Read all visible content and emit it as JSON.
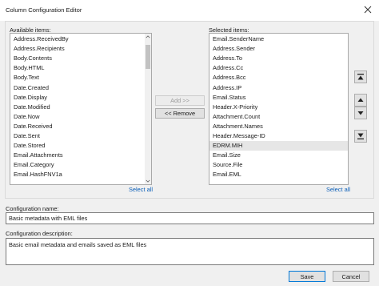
{
  "window": {
    "title": "Column Configuration Editor",
    "close_icon": "close-icon"
  },
  "available": {
    "label": "Available items:",
    "items": [
      "Address.ReceivedBy",
      "Address.Recipients",
      "Body.Contents",
      "Body.HTML",
      "Body.Text",
      "Date.Created",
      "Date.Display",
      "Date.Modified",
      "Date.Now",
      "Date.Received",
      "Date.Sent",
      "Date.Stored",
      "Email.Attachments",
      "Email.Category",
      "Email.HashFNV1a"
    ],
    "select_all": "Select all"
  },
  "selected": {
    "label": "Selected items:",
    "items": [
      "Email.SenderName",
      "Address.Sender",
      "Address.To",
      "Address.Cc",
      "Address.Bcc",
      "Address.IP",
      "Email.Status",
      "Header.X-Priority",
      "Attachment.Count",
      "Attachment.Names",
      "Header.Message-ID",
      "EDRM.MIH",
      "Email.Size",
      "Source.File",
      "Email.EML"
    ],
    "highlighted_index": 11,
    "select_all": "Select all"
  },
  "transfer": {
    "add_label": "Add >>",
    "remove_label": "<< Remove"
  },
  "order_icons": {
    "top": "move-to-top-icon",
    "up": "move-up-icon",
    "down": "move-down-icon",
    "bottom": "move-to-bottom-icon"
  },
  "configuration": {
    "name_label": "Configuration name:",
    "name_value": "Basic metadata with EML files",
    "description_label": "Configuration description:",
    "description_value": "Basic email metadata and emails saved as EML files"
  },
  "footer": {
    "save_label": "Save",
    "cancel_label": "Cancel"
  }
}
